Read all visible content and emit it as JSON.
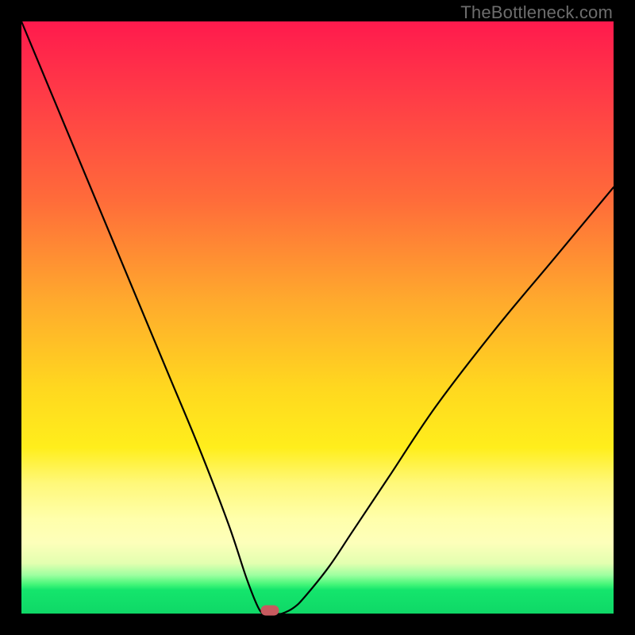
{
  "watermark": "TheBottleneck.com",
  "colors": {
    "frame": "#000000",
    "curve": "#000000",
    "marker": "#c75a5f"
  },
  "chart_data": {
    "type": "line",
    "title": "",
    "xlabel": "",
    "ylabel": "",
    "xlim": [
      0,
      100
    ],
    "ylim": [
      0,
      100
    ],
    "grid": false,
    "legend": false,
    "series": [
      {
        "name": "bottleneck-curve",
        "x": [
          0,
          5,
          10,
          15,
          20,
          25,
          30,
          35,
          38,
          40,
          41,
          42,
          43,
          44,
          46,
          48,
          52,
          56,
          62,
          70,
          80,
          90,
          100
        ],
        "values": [
          100,
          88,
          76,
          64,
          52,
          40,
          28,
          15,
          6,
          1,
          0,
          0,
          0,
          0,
          1,
          3,
          8,
          14,
          23,
          35,
          48,
          60,
          72
        ]
      }
    ],
    "marker": {
      "x": 42,
      "y": 0.5
    },
    "notes": "V-shaped curve dipping to zero (optimal/no bottleneck) near x≈42 against a vertical red-to-green gradient; no axis ticks or numeric labels are rendered in the image."
  }
}
